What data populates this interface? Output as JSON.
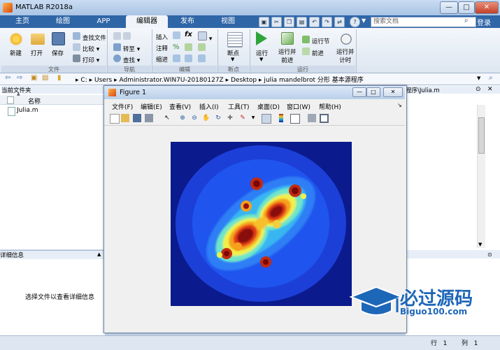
{
  "window": {
    "title": "MATLAB R2018a",
    "min": "—",
    "max": "□",
    "close": "✕"
  },
  "tabs": [
    {
      "label": "主页"
    },
    {
      "label": "绘图"
    },
    {
      "label": "APP"
    },
    {
      "label": "编辑器"
    },
    {
      "label": "发布"
    },
    {
      "label": "视图"
    }
  ],
  "search": {
    "placeholder": "搜索文档",
    "icon": "search-icon"
  },
  "login": "登录",
  "quick_tools": [
    "save-icon",
    "cut-icon",
    "copy-icon",
    "paste-icon",
    "undo-icon",
    "redo-icon",
    "switch-icon",
    "help-icon"
  ],
  "ribbon": {
    "file": {
      "label": "文件",
      "new": "新建",
      "open": "打开",
      "save": "保存",
      "find_files": "查找文件",
      "compare": "比较",
      "print": "打印"
    },
    "nav": {
      "label": "导航",
      "goto": "转至",
      "find": "查找"
    },
    "edit": {
      "label": "编辑",
      "insert": "插入",
      "comment": "注释",
      "indent": "缩进",
      "fx": "fx"
    },
    "breakpoint": {
      "label": "断点",
      "breakpoints": "断点"
    },
    "run": {
      "label": "运行",
      "run": "运行",
      "run_advance_1": "运行并",
      "run_advance_2": "前进",
      "run_section": "运行节",
      "advance": "前进",
      "run_time_1": "运行并",
      "run_time_2": "计时"
    }
  },
  "address": {
    "segments": [
      "C:",
      "Users",
      "Administrator.WIN7U-20180127Z",
      "Desktop",
      "julia mandelbrot 分形 基本源程序"
    ],
    "sep": "▸"
  },
  "current_folder": {
    "title": "当前文件夹",
    "col_name": "名称",
    "sort_arrow": "▲",
    "files": [
      "Julia.m"
    ]
  },
  "details": {
    "title": "详细信息",
    "message": "选择文件以查看详细信息"
  },
  "right_panel": {
    "title": "程序\\Julia.m"
  },
  "status": {
    "row_label": "行",
    "row": "1",
    "col_label": "列",
    "col": "1"
  },
  "figure": {
    "title": "Figure 1",
    "menus": [
      "文件(F)",
      "编辑(E)",
      "查看(V)",
      "插入(I)",
      "工具(T)",
      "桌面(D)",
      "窗口(W)",
      "帮助(H)"
    ],
    "tools": [
      "new-figure-icon",
      "open-icon",
      "save-icon",
      "print-icon",
      "pointer-icon",
      "zoom-in-icon",
      "zoom-out-icon",
      "pan-icon",
      "rotate-icon",
      "data-cursor-icon",
      "brush-icon",
      "link-icon",
      "colorbar-icon",
      "legend-icon",
      "hide-plot-tools-icon",
      "show-plot-tools-icon"
    ]
  },
  "watermark": {
    "text": "必过源码",
    "sub": "Biguo100.com"
  }
}
